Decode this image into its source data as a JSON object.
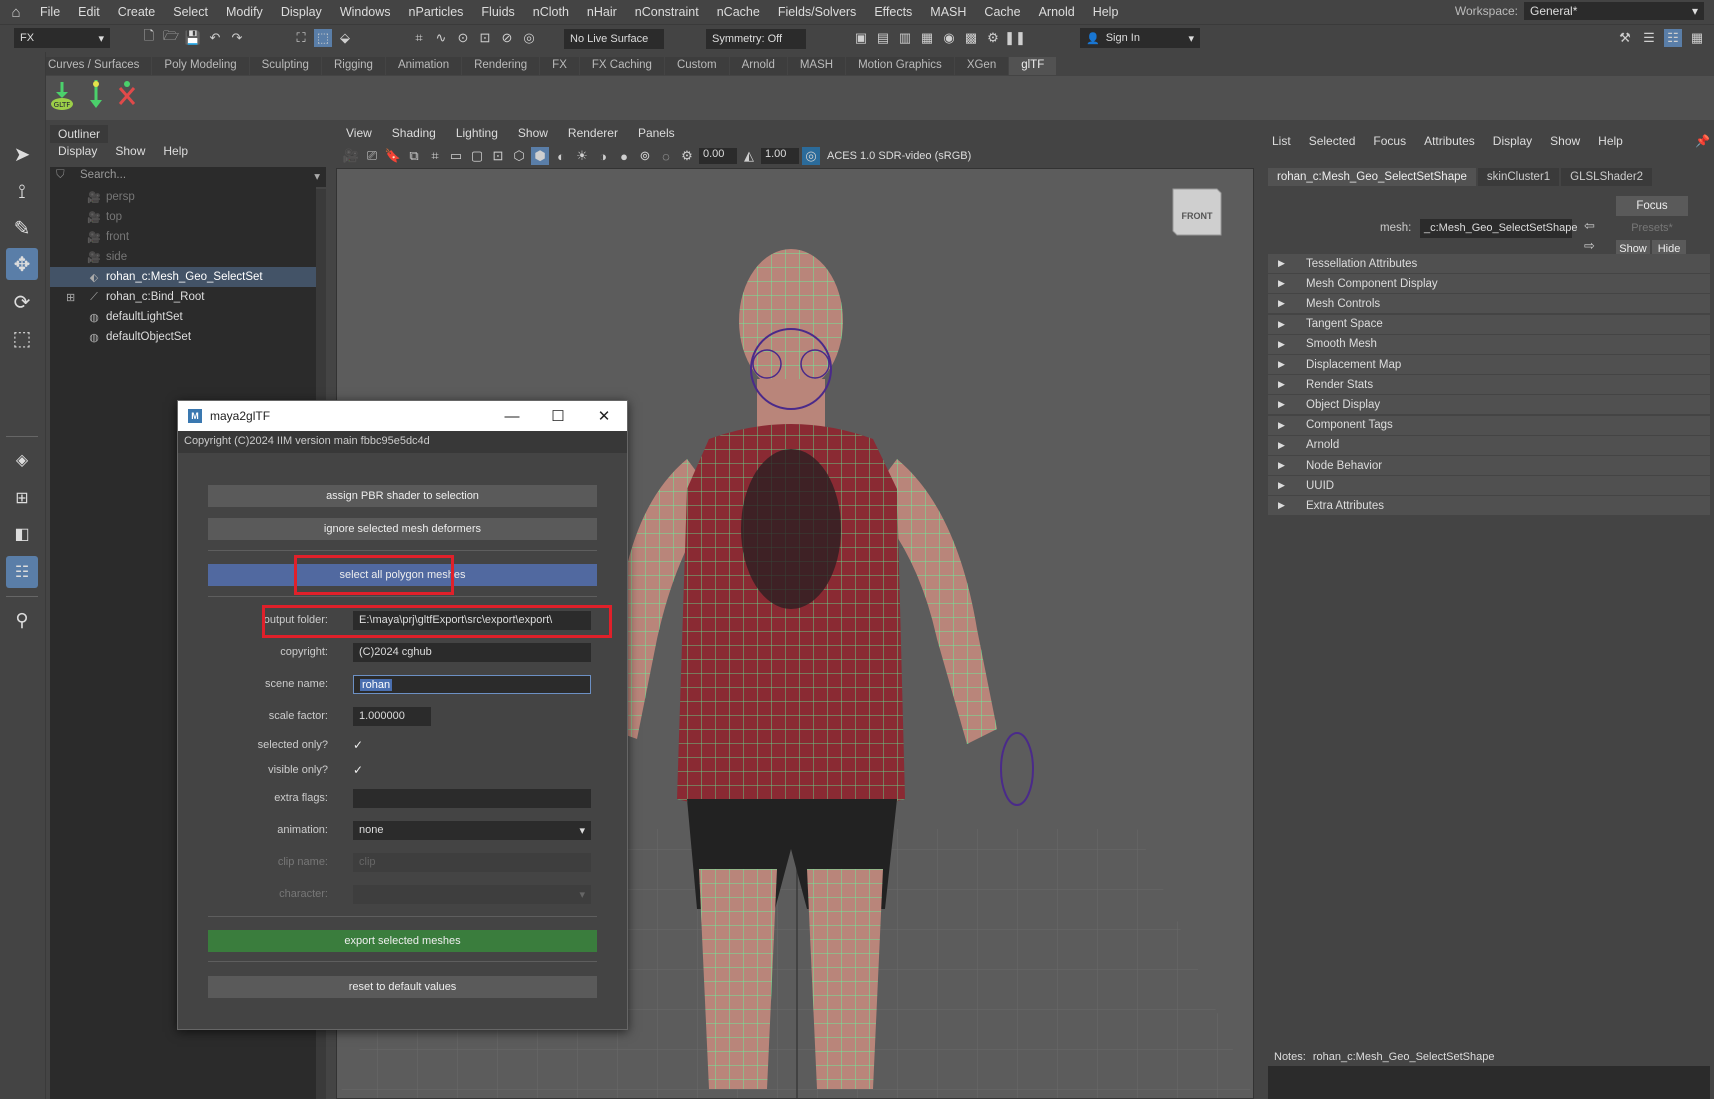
{
  "menubar": {
    "items": [
      "File",
      "Edit",
      "Create",
      "Select",
      "Modify",
      "Display",
      "Windows",
      "nParticles",
      "Fluids",
      "nCloth",
      "nHair",
      "nConstraint",
      "nCache",
      "Fields/Solvers",
      "Effects",
      "MASH",
      "Cache",
      "Arnold",
      "Help"
    ],
    "workspace_label": "Workspace:",
    "workspace_value": "General*"
  },
  "statusline": {
    "menuset": "FX",
    "live_surface": "No Live Surface",
    "symmetry": "Symmetry: Off",
    "sign_in": "Sign In"
  },
  "shelf": {
    "tabs": [
      "Curves / Surfaces",
      "Poly Modeling",
      "Sculpting",
      "Rigging",
      "Animation",
      "Rendering",
      "FX",
      "FX Caching",
      "Custom",
      "Arnold",
      "MASH",
      "Motion Graphics",
      "XGen",
      "glTF"
    ],
    "active_tab": "glTF"
  },
  "outliner": {
    "title": "Outliner",
    "menu": [
      "Display",
      "Show",
      "Help"
    ],
    "search_placeholder": "Search...",
    "items": [
      {
        "label": "persp",
        "icon": "camera-icon",
        "dim": true
      },
      {
        "label": "top",
        "icon": "camera-icon",
        "dim": true
      },
      {
        "label": "front",
        "icon": "camera-icon",
        "dim": true
      },
      {
        "label": "side",
        "icon": "camera-icon",
        "dim": true
      },
      {
        "label": "rohan_c:Mesh_Geo_SelectSet",
        "icon": "selection-set-icon",
        "selected": true
      },
      {
        "label": "rohan_c:Bind_Root",
        "icon": "joint-icon",
        "expandable": true
      },
      {
        "label": "defaultLightSet",
        "icon": "set-icon"
      },
      {
        "label": "defaultObjectSet",
        "icon": "set-icon"
      }
    ]
  },
  "viewport": {
    "menu": [
      "View",
      "Shading",
      "Lighting",
      "Show",
      "Renderer",
      "Panels"
    ],
    "field_a": "0.00",
    "field_b": "1.00",
    "color_space": "ACES 1.0 SDR-video (sRGB)",
    "viewcube_label": "FRONT"
  },
  "attribute_editor": {
    "menu": [
      "List",
      "Selected",
      "Focus",
      "Attributes",
      "Display",
      "Show",
      "Help"
    ],
    "tabs": [
      "rohan_c:Mesh_Geo_SelectSetShape",
      "skinCluster1",
      "GLSLShader2"
    ],
    "mesh_label": "mesh:",
    "mesh_value": "_c:Mesh_Geo_SelectSetShape",
    "focus_button": "Focus",
    "presets_button": "Presets*",
    "show_button": "Show",
    "hide_button": "Hide",
    "sections": [
      "Tessellation Attributes",
      "Mesh Component Display",
      "Mesh Controls",
      "Tangent Space",
      "Smooth Mesh",
      "Displacement Map",
      "Render Stats",
      "Object Display",
      "Component Tags",
      "Arnold",
      "Node Behavior",
      "UUID",
      "Extra Attributes"
    ],
    "notes_label": "Notes:",
    "notes_value": "rohan_c:Mesh_Geo_SelectSetShape"
  },
  "dialog": {
    "title": "maya2glTF",
    "copyright_line": "Copyright (C)2024 IIM    version main fbbc95e5dc4d",
    "btn_assign": "assign PBR shader to selection",
    "btn_ignore": "ignore selected mesh deformers",
    "btn_select_all": "select all polygon meshes",
    "output_folder_label": "output folder:",
    "output_folder_value": "E:\\maya\\prj\\gltfExport\\src\\export\\export\\",
    "copyright_label": "copyright:",
    "copyright_value": "(C)2024 cghub",
    "scene_name_label": "scene name:",
    "scene_name_value": "rohan",
    "scale_factor_label": "scale factor:",
    "scale_factor_value": "1.000000",
    "selected_only_label": "selected only?",
    "selected_only_checked": true,
    "visible_only_label": "visible only?",
    "visible_only_checked": true,
    "extra_flags_label": "extra flags:",
    "extra_flags_value": "",
    "animation_label": "animation:",
    "animation_value": "none",
    "clip_name_label": "clip name:",
    "clip_name_placeholder": "clip",
    "character_label": "character:",
    "character_value": "",
    "btn_export": "export selected meshes",
    "btn_reset": "reset to default values"
  },
  "colors": {
    "highlight_red": "#e0202a",
    "select_blue": "#5169a0",
    "export_green": "#3a7d3d",
    "wireframe_green": "#5dffa0"
  }
}
